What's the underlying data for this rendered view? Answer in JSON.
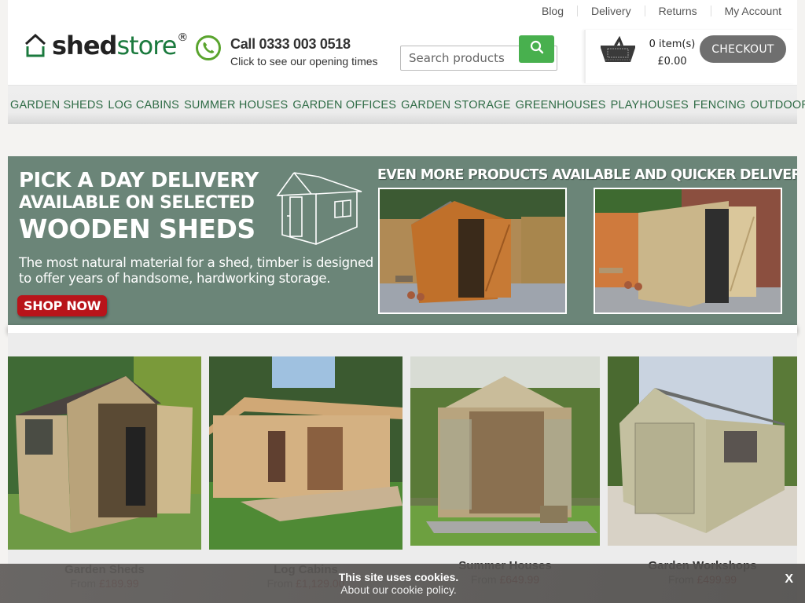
{
  "header": {
    "top_links": [
      "Blog",
      "Delivery",
      "Returns",
      "My Account"
    ],
    "logo": {
      "part1": "shed",
      "part2": "store",
      "registered": "®"
    },
    "phone": {
      "icon": "phone-icon",
      "number": "Call 0333 003 0518",
      "subtitle": "Click to see our opening times"
    },
    "search": {
      "placeholder": "Search products",
      "value": "",
      "icon": "search-icon"
    },
    "cart": {
      "icon": "basket-icon",
      "items": "0 item(s)",
      "total": "£0.00",
      "checkout_label": "CHECKOUT"
    }
  },
  "nav": {
    "items": [
      "GARDEN SHEDS",
      "LOG CABINS",
      "SUMMER HOUSES",
      "GARDEN OFFICES",
      "GARDEN STORAGE",
      "GREENHOUSES",
      "PLAYHOUSES",
      "FENCING",
      "OUTDOOR LIVING"
    ]
  },
  "banner": {
    "line1": "PICK A DAY DELIVERY",
    "line2": "AVAILABLE ON SELECTED",
    "line3": "WOODEN SHEDS",
    "description_line1": "The most natural material for a shed, timber is designed",
    "description_line2": "to offer years of handsome, hardworking storage.",
    "cta": "SHOP NOW",
    "right_title": "EVEN MORE PRODUCTS AVAILABLE AND QUICKER DELIVERY",
    "bg_color": "#6b8578"
  },
  "categories": [
    {
      "name": "Garden Sheds",
      "from_label": "From",
      "price": "£189.99"
    },
    {
      "name": "Log Cabins",
      "from_label": "From",
      "price": "£1,129.00"
    },
    {
      "name": "Summer Houses",
      "from_label": "From",
      "price": "£649.99"
    },
    {
      "name": "Garden Workshops",
      "from_label": "From",
      "price": "£499.99"
    }
  ],
  "cookie": {
    "line1": "This site uses cookies.",
    "line2": "About our cookie policy.",
    "close_label": "X"
  },
  "colors": {
    "brand_green": "#1b7a3e",
    "nav_text": "#2e6b45",
    "search_button": "#48b04e",
    "checkout": "#6f6f6f",
    "price": "#b43a3a",
    "shop_now": "#b8141a"
  }
}
